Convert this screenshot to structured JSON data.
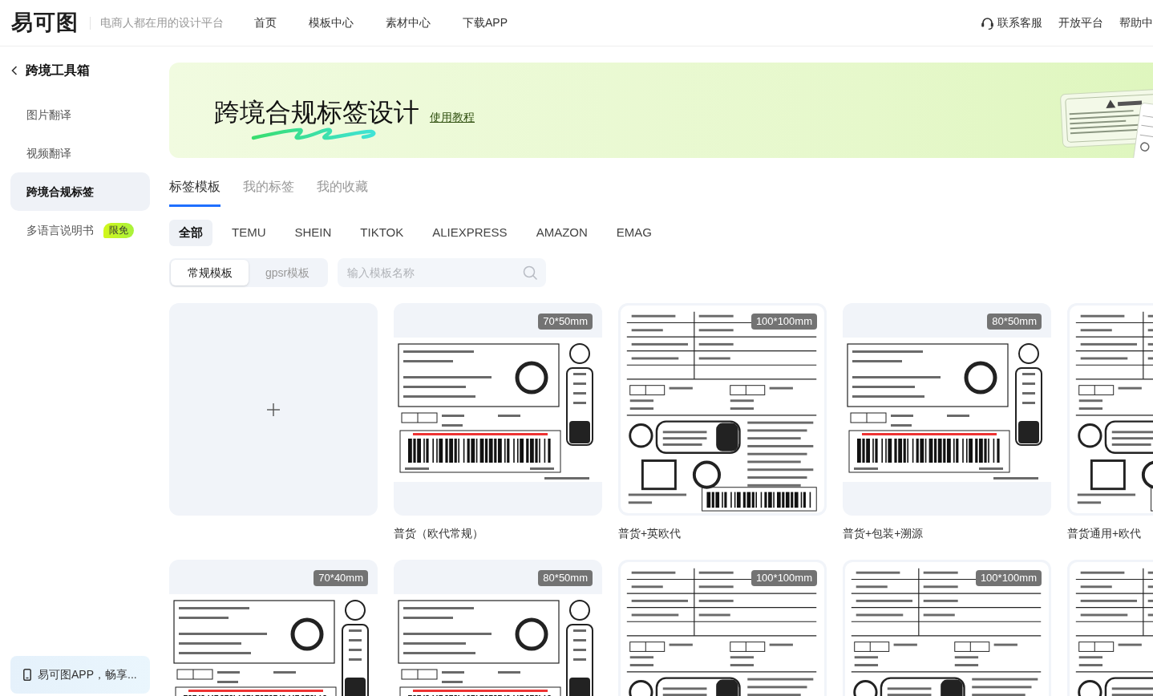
{
  "header": {
    "logo": "易可图",
    "tagline": "电商人都在用的设计平台",
    "nav": [
      {
        "label": "首页"
      },
      {
        "label": "模板中心"
      },
      {
        "label": "素材中心"
      },
      {
        "label": "下载APP"
      }
    ],
    "links": [
      {
        "kind": "support",
        "label": "联系客服"
      },
      {
        "kind": "plain",
        "label": "开放平台"
      },
      {
        "kind": "plain",
        "label": "帮助中"
      }
    ]
  },
  "sidebar": {
    "title": "跨境工具箱",
    "items": [
      {
        "label": "图片翻译",
        "selected": false
      },
      {
        "label": "视频翻译",
        "selected": false
      },
      {
        "label": "跨境合规标签",
        "selected": true
      },
      {
        "label": "多语言说明书",
        "selected": false,
        "badge": "限免"
      }
    ],
    "promo": "易可图APP，畅享..."
  },
  "banner": {
    "title": "跨境合规标签设计",
    "link": "使用教程"
  },
  "tabs": [
    {
      "label": "标签模板",
      "selected": true
    },
    {
      "label": "我的标签",
      "selected": false
    },
    {
      "label": "我的收藏",
      "selected": false
    }
  ],
  "platforms": [
    {
      "label": "全部",
      "selected": true
    },
    {
      "label": "TEMU",
      "selected": false
    },
    {
      "label": "SHEIN",
      "selected": false
    },
    {
      "label": "TIKTOK",
      "selected": false
    },
    {
      "label": "ALIEXPRESS",
      "selected": false
    },
    {
      "label": "AMAZON",
      "selected": false
    },
    {
      "label": "EMAG",
      "selected": false
    }
  ],
  "template_types": [
    {
      "label": "常规模板",
      "selected": true
    },
    {
      "label": "gpsr模板",
      "selected": false
    }
  ],
  "search": {
    "placeholder": "输入模板名称"
  },
  "templates": [
    {
      "kind": "create"
    },
    {
      "kind": "landscape",
      "size": "70*50mm",
      "title": "普货（欧代常规）"
    },
    {
      "kind": "square",
      "size": "100*100mm",
      "title": "普货+英欧代"
    },
    {
      "kind": "landscape",
      "size": "80*50mm",
      "title": "普货+包装+溯源"
    },
    {
      "kind": "square",
      "title": "普货通用+欧代"
    },
    {
      "kind": "landscape",
      "size": "70*40mm"
    },
    {
      "kind": "landscape",
      "size": "80*50mm"
    },
    {
      "kind": "square",
      "size": "100*100mm"
    },
    {
      "kind": "square",
      "size": "100*100mm"
    },
    {
      "kind": "square"
    }
  ]
}
